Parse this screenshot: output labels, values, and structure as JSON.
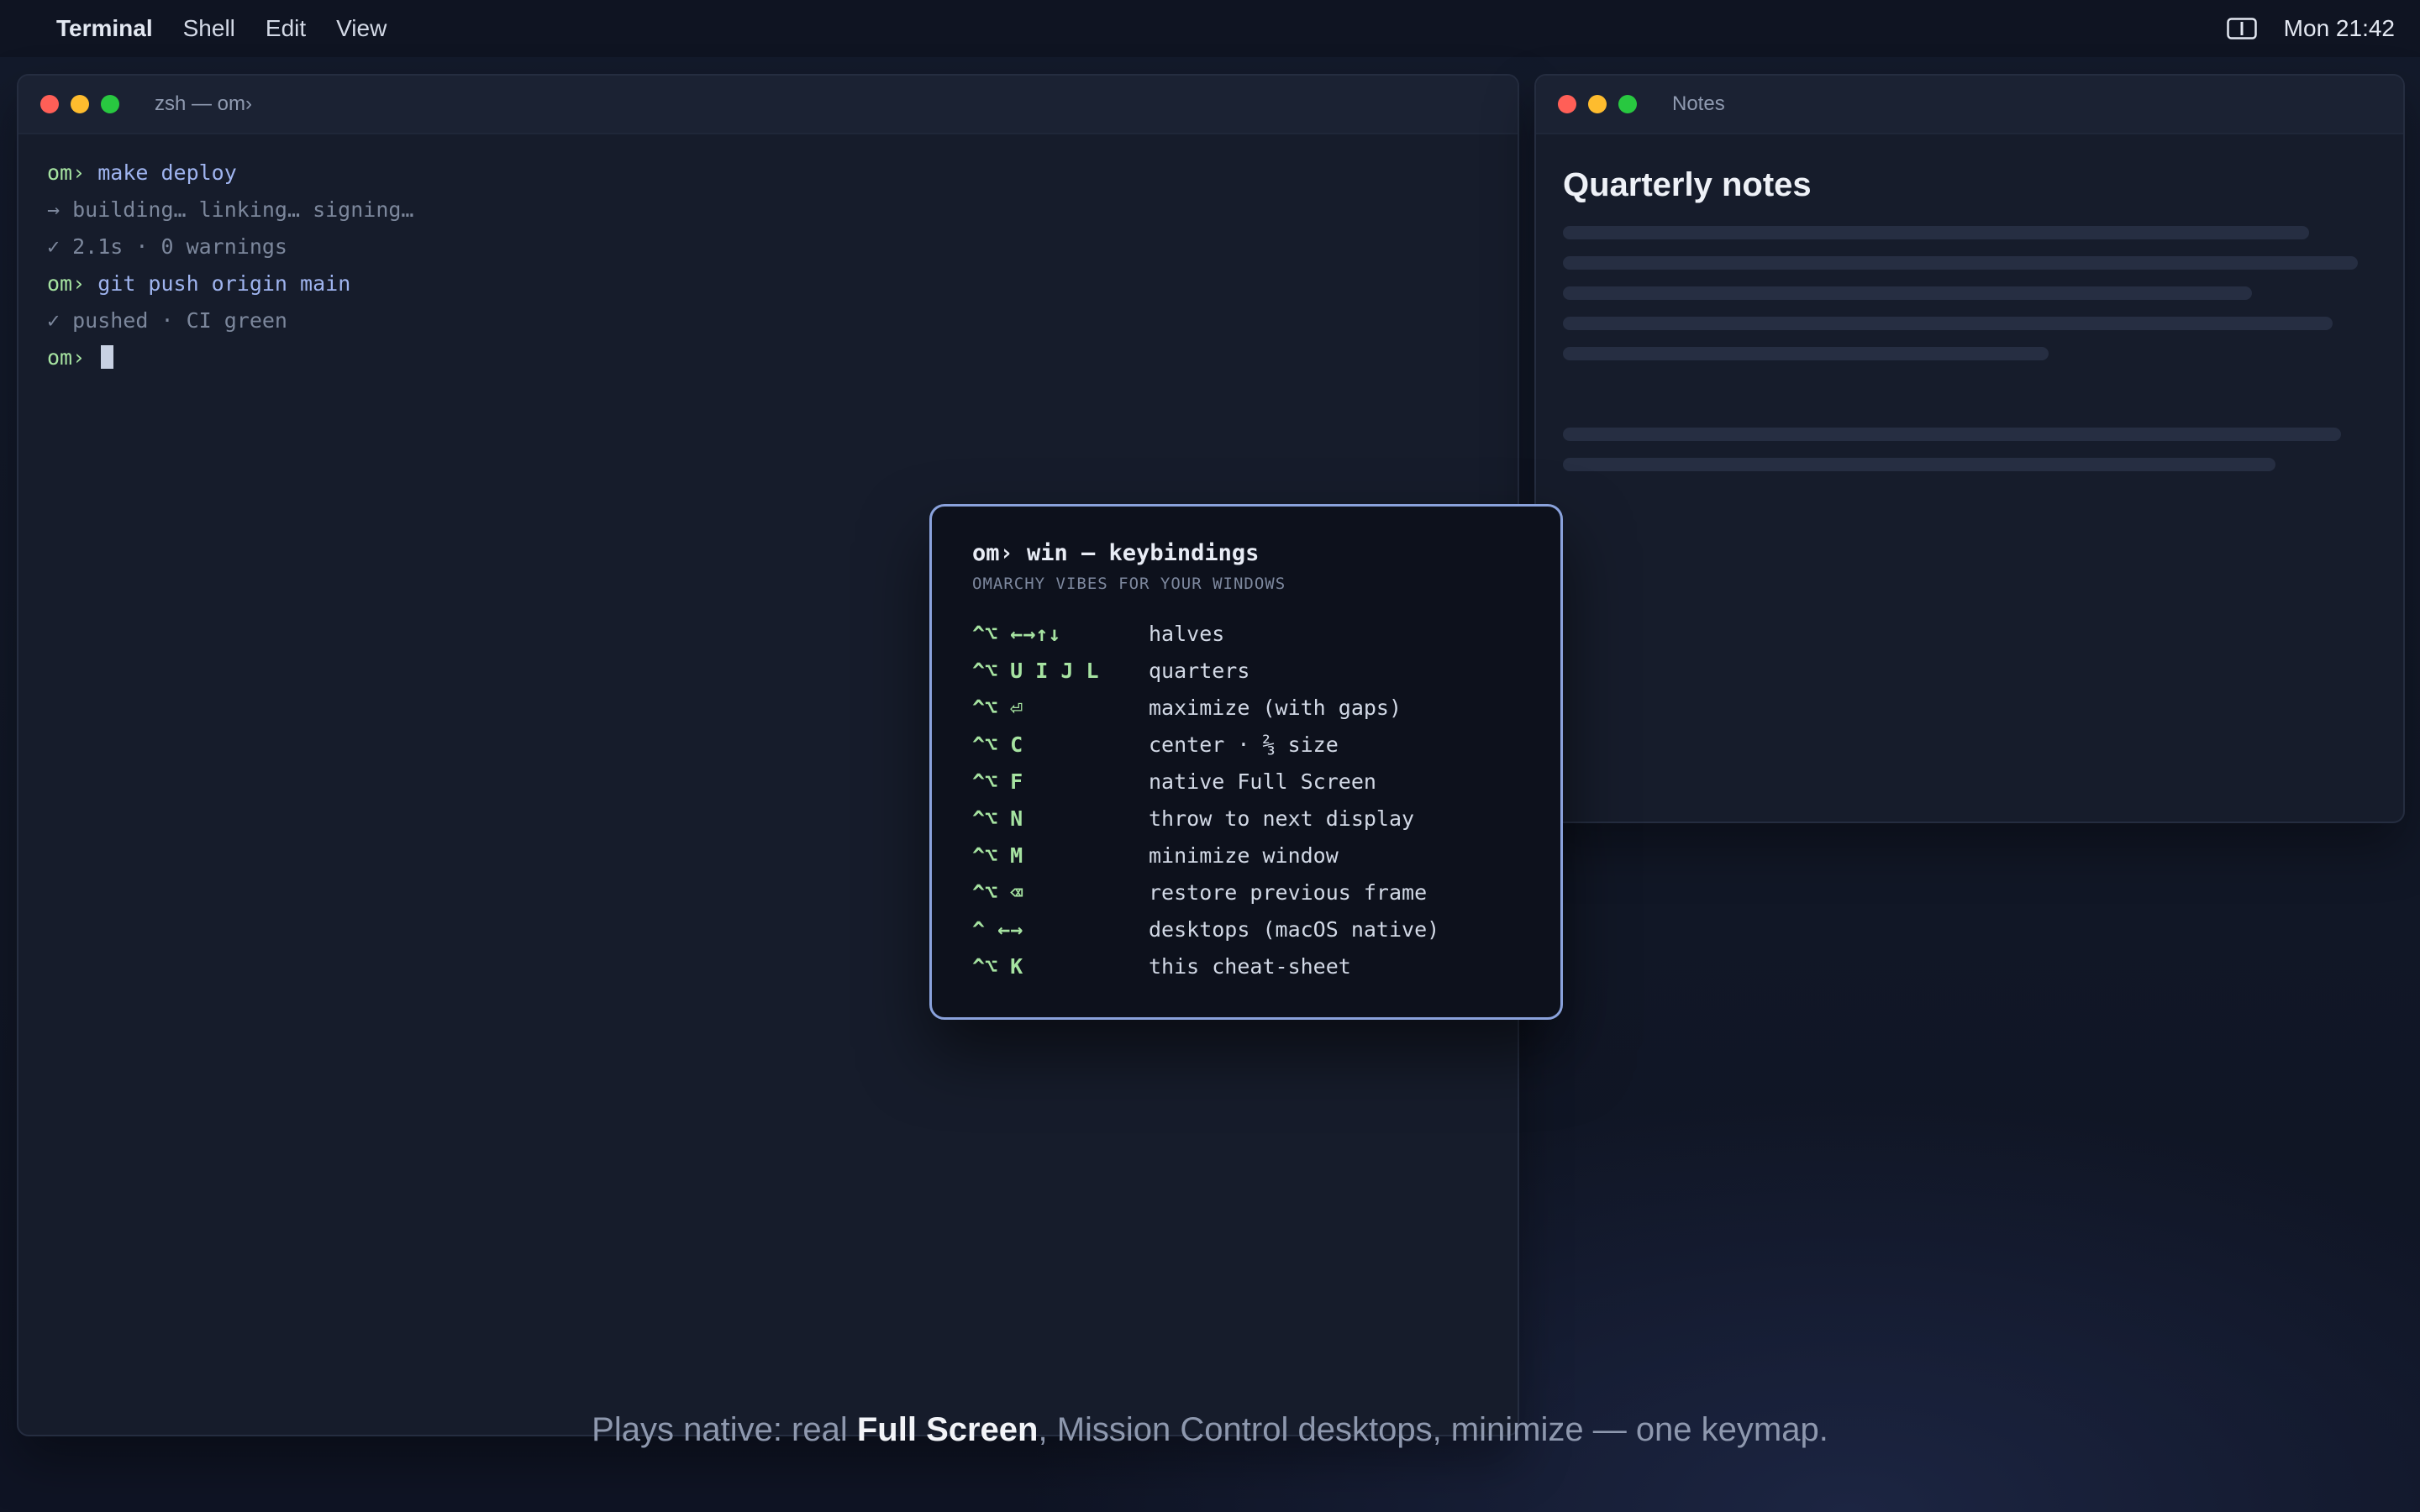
{
  "menubar": {
    "app": "Terminal",
    "items": [
      "Shell",
      "Edit",
      "View"
    ],
    "clock": "Mon 21:42",
    "status_icon": "sidebar-toggle-icon"
  },
  "terminal": {
    "title": "zsh — om›",
    "lines": [
      {
        "prompt": "om›",
        "text": "make deploy"
      },
      {
        "text": "→ building… linking… signing…"
      },
      {
        "text": "✓ 2.1s · 0 warnings"
      },
      {
        "prompt": "om›",
        "text": "git push origin main"
      },
      {
        "text": "✓ pushed · CI green"
      },
      {
        "prompt": "om›",
        "text": ""
      }
    ]
  },
  "notes": {
    "title": "Notes",
    "heading": "Quarterly notes"
  },
  "overlay": {
    "title": "om› win — keybindings",
    "subtitle": "OMARCHY VIBES FOR YOUR WINDOWS",
    "bindings": [
      {
        "keys": "^⌥ ←→↑↓",
        "action": "halves"
      },
      {
        "keys": "^⌥ U I J L",
        "action": "quarters"
      },
      {
        "keys": "^⌥ ⏎",
        "action": "maximize (with gaps)"
      },
      {
        "keys": "^⌥ C",
        "action": "center · ⅔ size"
      },
      {
        "keys": "^⌥ F",
        "action": "native Full Screen"
      },
      {
        "keys": "^⌥ N",
        "action": "throw to next display"
      },
      {
        "keys": "^⌥ M",
        "action": "minimize window"
      },
      {
        "keys": "^⌥ ⌫",
        "action": "restore previous frame"
      },
      {
        "keys": "^ ←→",
        "action": "desktops (macOS native)"
      },
      {
        "keys": "^⌥ K",
        "action": "this cheat-sheet"
      }
    ]
  },
  "caption": {
    "before": "Plays native: real ",
    "bold": "Full Screen",
    "after": ", Mission Control desktops, minimize — one keymap."
  },
  "colors": {
    "prompt": "#a6e3a1",
    "command": "#9fb4ef",
    "overlay_border": "#8aa2dc",
    "traffic_red": "#ff5f57",
    "traffic_yellow": "#febc2e",
    "traffic_green": "#28c840"
  }
}
